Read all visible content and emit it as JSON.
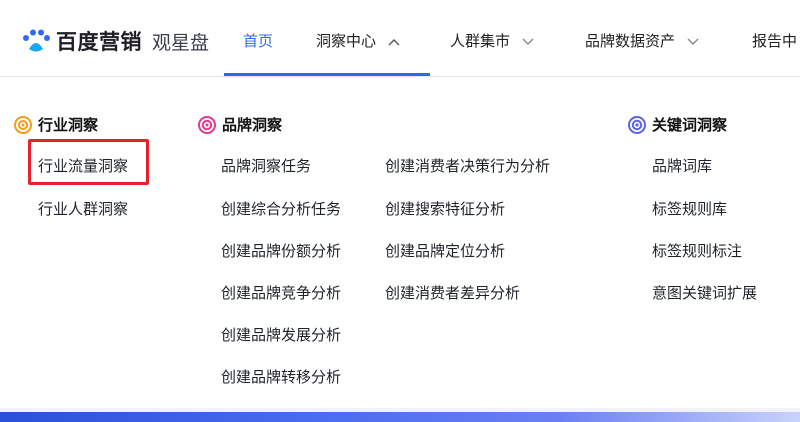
{
  "logo": {
    "brand": "百度营销",
    "product": "观星盘"
  },
  "nav": [
    {
      "label": "首页",
      "active": true
    },
    {
      "label": "洞察中心",
      "active": false,
      "chevron": "up"
    },
    {
      "label": "人群集市",
      "active": false,
      "chevron": "down"
    },
    {
      "label": "品牌数据资产",
      "active": false,
      "chevron": "down"
    },
    {
      "label": "报告中",
      "active": false
    }
  ],
  "dropdown": {
    "industry": {
      "title": "行业洞察",
      "icon": "industry-insight-icon",
      "items": [
        "行业流量洞察",
        "行业人群洞察"
      ],
      "highlighted": "行业流量洞察"
    },
    "brand": {
      "title": "品牌洞察",
      "icon": "brand-insight-icon",
      "col1": [
        "品牌洞察任务",
        "创建综合分析任务",
        "创建品牌份额分析",
        "创建品牌竞争分析",
        "创建品牌发展分析",
        "创建品牌转移分析"
      ],
      "col2": [
        "创建消费者决策行为分析",
        "创建搜索特征分析",
        "创建品牌定位分析",
        "创建消费者差异分析"
      ]
    },
    "keyword": {
      "title": "关键词洞察",
      "icon": "keyword-insight-icon",
      "items": [
        "品牌词库",
        "标签规则库",
        "标签规则标注",
        "意图关键词扩展"
      ]
    }
  },
  "colors": {
    "accent": "#3166f5",
    "highlight_border": "#e8212a",
    "industry_icon": "#f59a1b",
    "brand_icon": "#e5398c",
    "keyword_icon": "#5a63e8"
  }
}
